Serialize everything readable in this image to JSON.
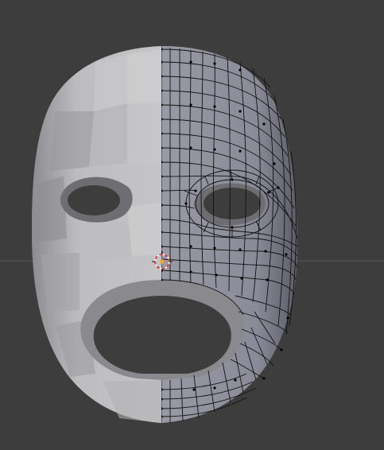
{
  "viewport": {
    "name": "3d-viewport",
    "background": "#3d3d3d",
    "horizon_color": "#5a5a5a"
  },
  "mesh": {
    "name": "mask",
    "left_half_shading": "solid",
    "right_half_mode": "edit-wireframe",
    "base_color": "#a9a9ad",
    "wire_color": "#0a0a0a"
  },
  "cursor": {
    "icon": "3d-cursor-icon",
    "ring_color_a": "#d04040",
    "ring_color_b": "#f0f0f0",
    "center_color": "#e8a040"
  }
}
